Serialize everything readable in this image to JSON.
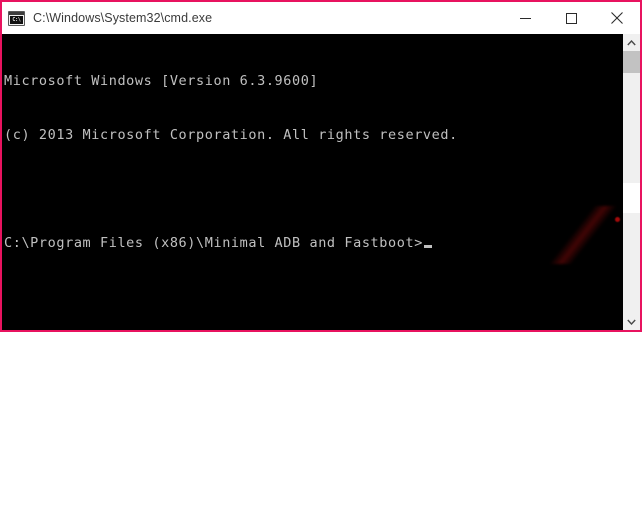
{
  "window": {
    "title": "C:\\Windows\\System32\\cmd.exe",
    "app_icon_name": "cmd-exe-icon",
    "icon_glyph": "C:\\",
    "border_color": "#e8135f",
    "titlebar_bg": "#ffffff",
    "titlebar_text_color": "#3b3b3b"
  },
  "controls": {
    "minimize_label": "Minimize",
    "maximize_label": "Maximize",
    "close_label": "Close"
  },
  "console": {
    "background": "#000000",
    "foreground": "#c0c0c0",
    "lines": [
      "Microsoft Windows [Version 6.3.9600]",
      "(c) 2013 Microsoft Corporation. All rights reserved.",
      "",
      "C:\\Program Files (x86)\\Minimal ADB and Fastboot>"
    ],
    "line_1": "Microsoft Windows [Version 6.3.9600]",
    "line_2": "(c) 2013 Microsoft Corporation. All rights reserved.",
    "line_3": "",
    "line_4": "C:\\Program Files (x86)\\Minimal ADB and Fastboot>",
    "os_name": "Microsoft Windows",
    "os_version": "6.3.9600",
    "copyright_year": "2013",
    "copyright_holder": "Microsoft Corporation",
    "copyright_notice": "All rights reserved.",
    "current_directory": "C:\\Program Files (x86)\\Minimal ADB and Fastboot",
    "prompt_symbol": ">",
    "cursor_visible": "true"
  },
  "scrollbar": {
    "up_arrow_name": "scroll-up-arrow",
    "down_arrow_name": "scroll-down-arrow",
    "thumb_name": "scroll-thumb",
    "track_color": "#f0f0f0",
    "thumb_color": "#c2c2c2"
  }
}
